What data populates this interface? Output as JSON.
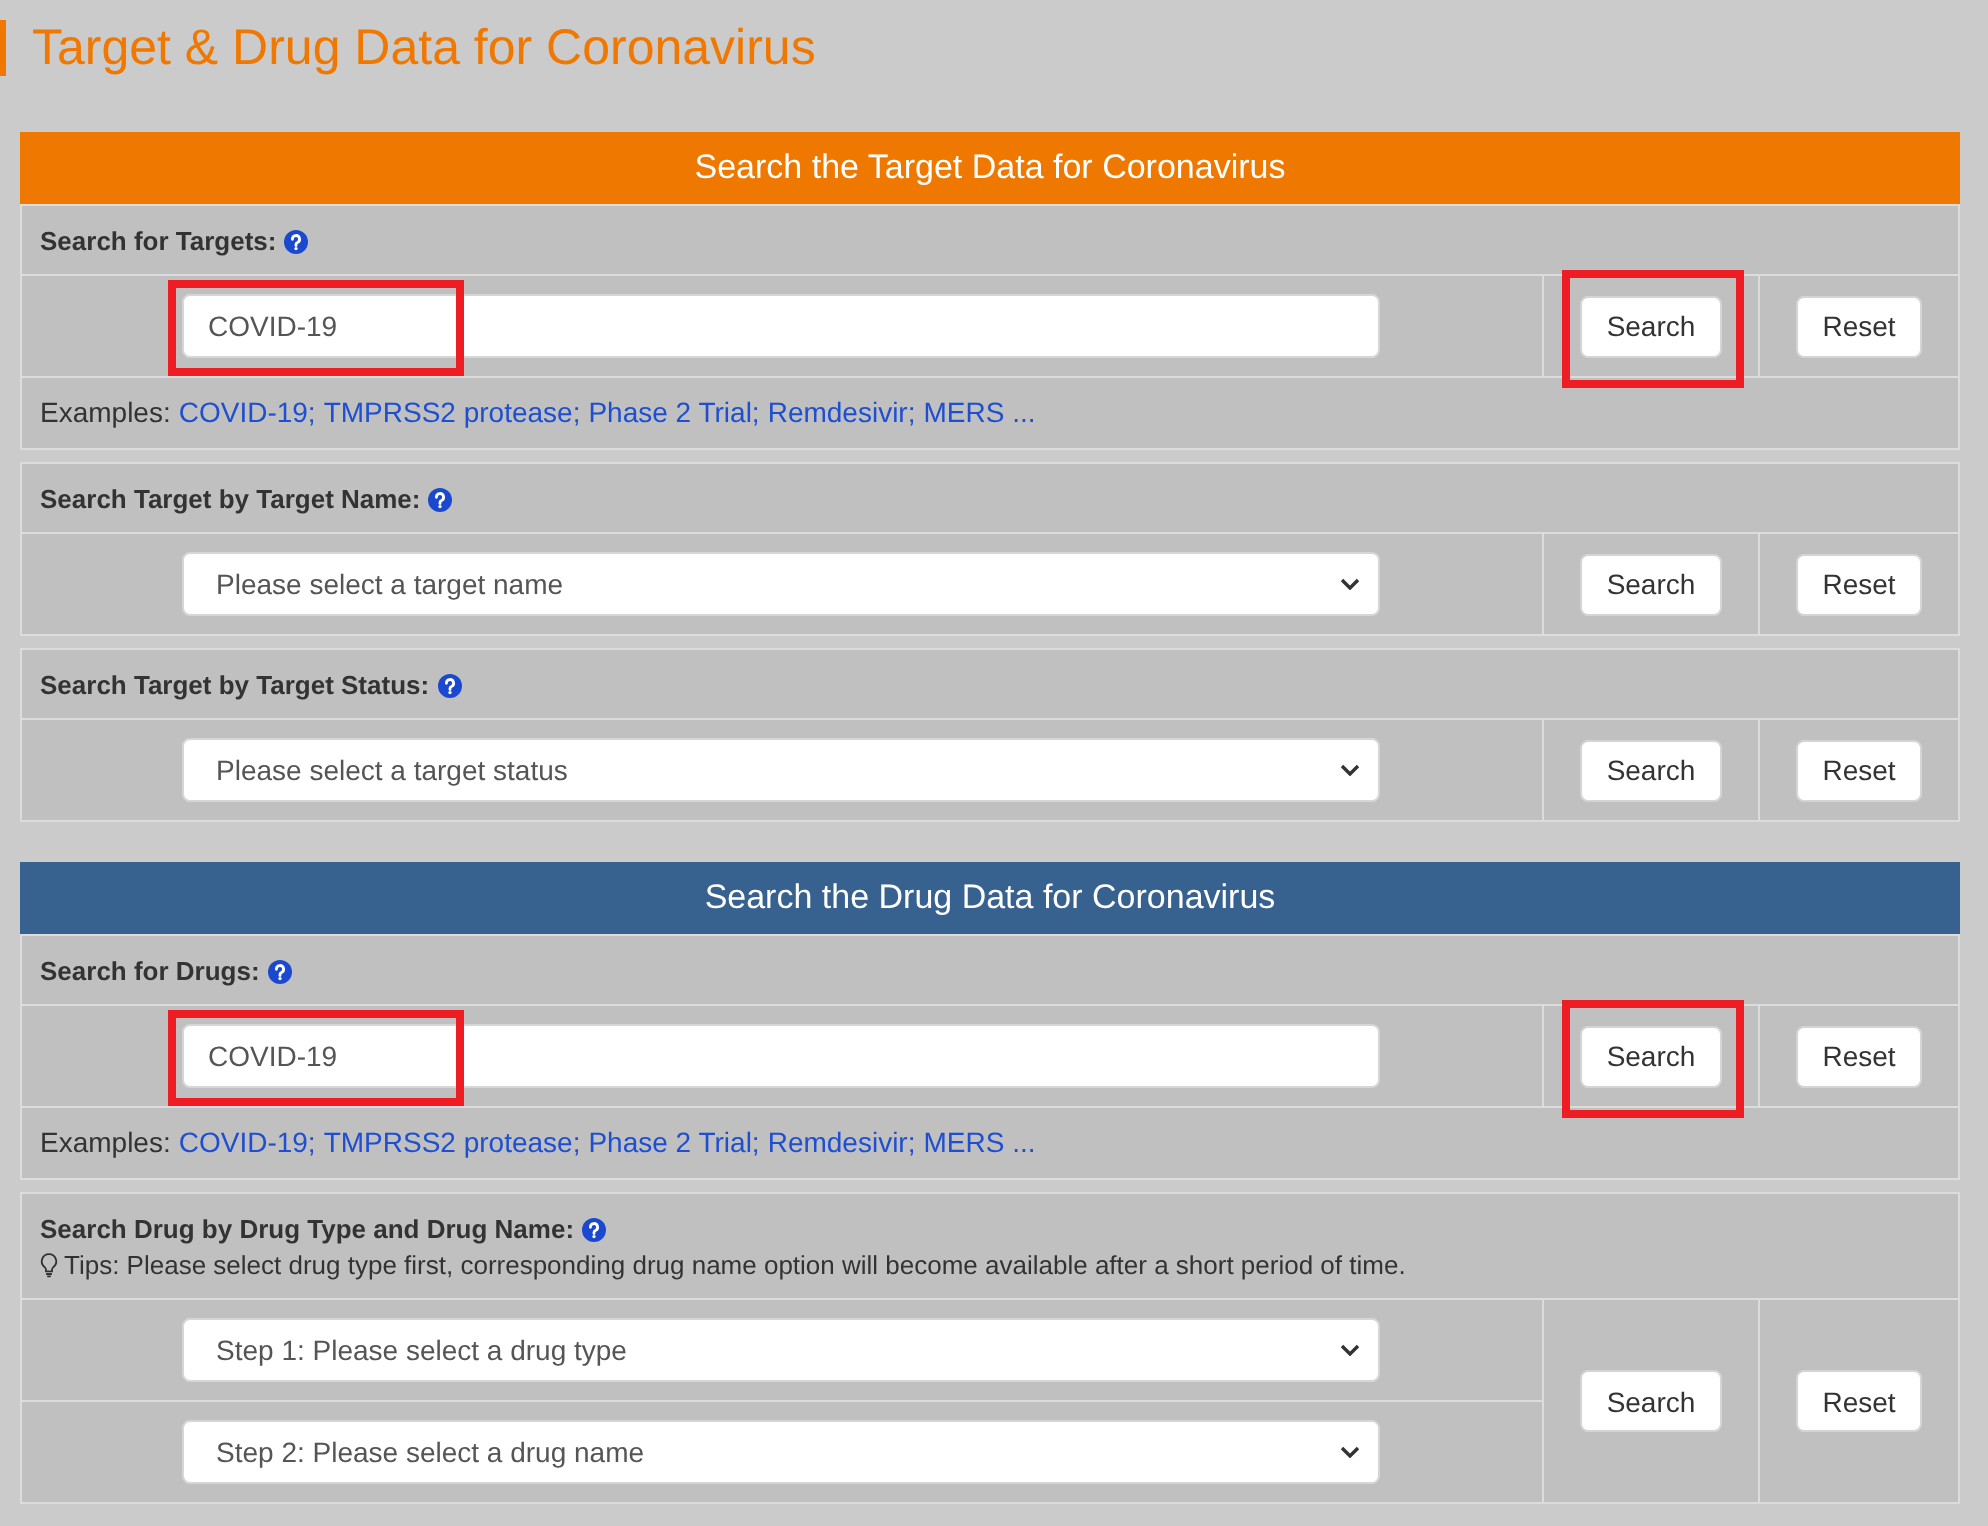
{
  "page": {
    "title": "Target & Drug Data for Coronavirus"
  },
  "sections": [
    {
      "header": "Search the Target Data for Coronavirus",
      "color": "#ef7800",
      "panels": [
        {
          "kind": "text",
          "label": "Search for Targets:",
          "field": {
            "value": "COVID-19",
            "highlighted": true
          },
          "search": {
            "label": "Search",
            "highlighted": true
          },
          "reset": {
            "label": "Reset"
          },
          "examples": {
            "label": "Examples:",
            "links": [
              "COVID-19;",
              "TMPRSS2 protease;",
              "Phase 2 Trial;",
              "Remdesivir;",
              "MERS ..."
            ]
          }
        },
        {
          "kind": "select",
          "label": "Search Target by Target Name:",
          "selects": [
            {
              "placeholder": "Please select a target name"
            }
          ],
          "search": {
            "label": "Search",
            "highlighted": false
          },
          "reset": {
            "label": "Reset"
          }
        },
        {
          "kind": "select",
          "label": "Search Target by Target Status:",
          "selects": [
            {
              "placeholder": "Please select a target status"
            }
          ],
          "search": {
            "label": "Search",
            "highlighted": false
          },
          "reset": {
            "label": "Reset"
          }
        }
      ]
    },
    {
      "header": "Search the Drug Data for Coronavirus",
      "color": "#37618f",
      "panels": [
        {
          "kind": "text",
          "label": "Search for Drugs:",
          "field": {
            "value": "COVID-19",
            "highlighted": true
          },
          "search": {
            "label": "Search",
            "highlighted": true
          },
          "reset": {
            "label": "Reset"
          },
          "examples": {
            "label": "Examples:",
            "links": [
              "COVID-19;",
              "TMPRSS2 protease;",
              "Phase 2 Trial;",
              "Remdesivir;",
              "MERS ..."
            ]
          }
        },
        {
          "kind": "select",
          "label": "Search Drug by Drug Type and Drug Name:",
          "tips": "Tips: Please select drug type first, corresponding drug name option will become available after a short period of time.",
          "selects": [
            {
              "placeholder": "Step 1: Please select a drug type"
            },
            {
              "placeholder": "Step 2: Please select a drug name"
            }
          ],
          "search": {
            "label": "Search",
            "highlighted": false
          },
          "reset": {
            "label": "Reset"
          }
        }
      ]
    }
  ]
}
